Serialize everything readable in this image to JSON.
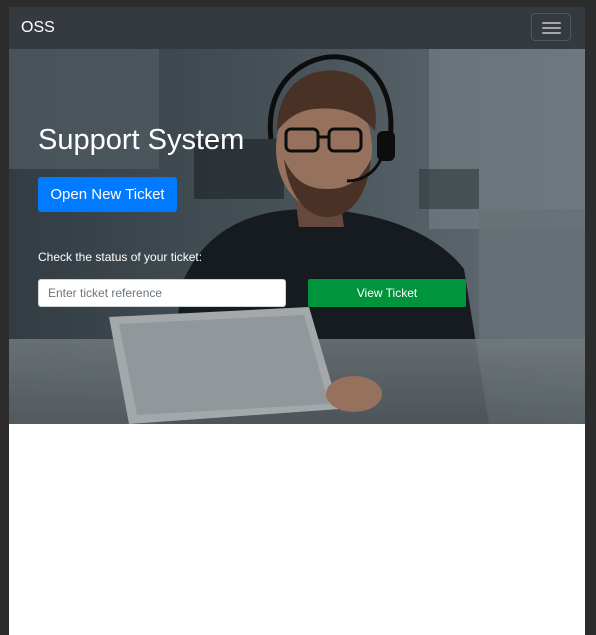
{
  "navbar": {
    "brand": "OSS",
    "toggler_icon": "hamburger-menu-icon"
  },
  "hero": {
    "background": "photo of a support agent wearing a headset at a laptop",
    "title": "Support System",
    "open_ticket_label": "Open New Ticket",
    "status_label": "Check the status of your ticket:",
    "ticket_input": {
      "value": "",
      "placeholder": "Enter ticket reference"
    },
    "view_ticket_label": "View Ticket"
  },
  "colors": {
    "navbar_bg": "#343a40",
    "primary_button": "#007bff",
    "success_button": "#00943c",
    "page_bg": "#ffffff",
    "outer_bg": "#2c2c2c"
  }
}
